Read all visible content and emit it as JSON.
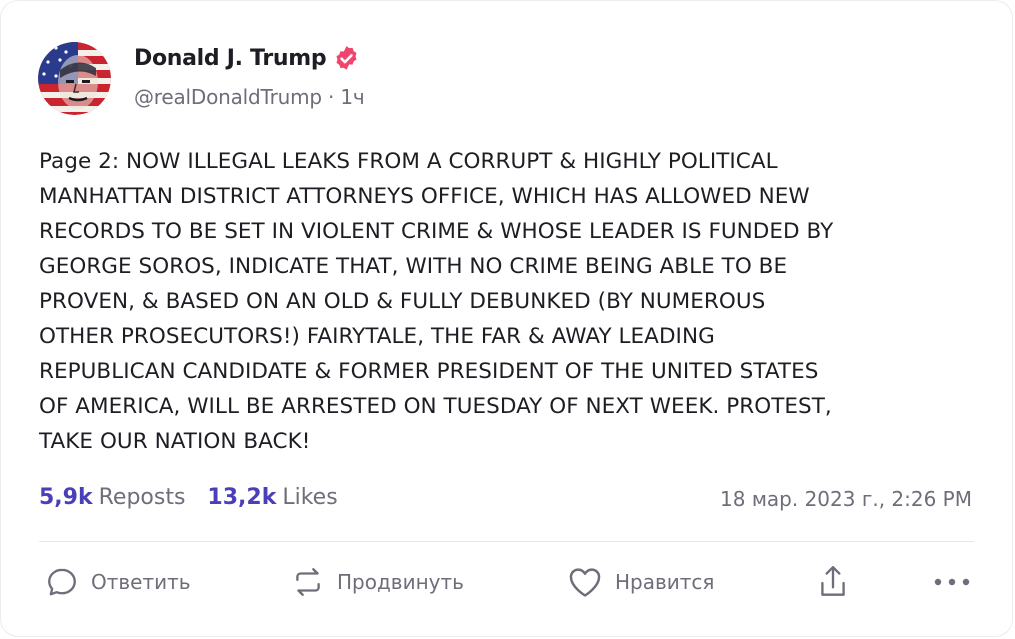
{
  "author": {
    "display_name": "Donald J. Trump",
    "handle": "@realDonaldTrump",
    "separator": "·",
    "time_ago": "1ч",
    "verified": true,
    "verified_badge_color": "#f0446d"
  },
  "post": {
    "text": "Page 2: NOW ILLEGAL LEAKS FROM A CORRUPT & HIGHLY POLITICAL\nMANHATTAN DISTRICT ATTORNEYS OFFICE, WHICH HAS ALLOWED NEW\nRECORDS TO BE SET IN VIOLENT CRIME & WHOSE LEADER IS FUNDED BY\nGEORGE SOROS, INDICATE THAT, WITH NO CRIME BEING ABLE TO BE\nPROVEN, & BASED ON AN OLD & FULLY DEBUNKED (BY NUMEROUS\nOTHER PROSECUTORS!) FAIRYTALE, THE FAR & AWAY LEADING\nREPUBLICAN CANDIDATE & FORMER PRESIDENT OF THE UNITED STATES\nOF AMERICA, WILL BE ARRESTED ON TUESDAY OF NEXT WEEK. PROTEST,\nTAKE OUR NATION BACK!"
  },
  "stats": {
    "reposts_count": "5,9k",
    "reposts_label": "Reposts",
    "likes_count": "13,2k",
    "likes_label": "Likes",
    "timestamp": "18 мар. 2023 г., 2:26 PM",
    "accent_color": "#4a3fb8"
  },
  "actions": {
    "reply_label": "Ответить",
    "repost_label": "Продвинуть",
    "like_label": "Нравится",
    "share_icon": "share-icon",
    "more_icon": "more-icon"
  }
}
